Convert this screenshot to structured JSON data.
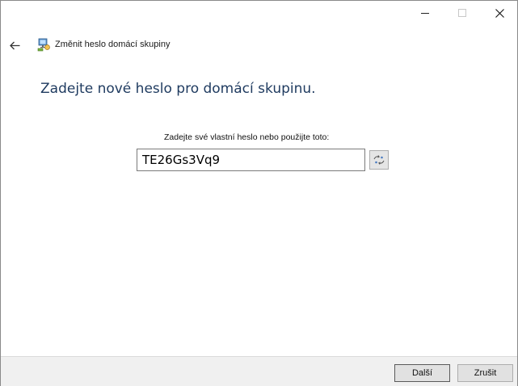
{
  "window": {
    "minimize_icon": "minimize-icon",
    "maximize_icon": "maximize-icon",
    "close_icon": "close-icon"
  },
  "nav": {
    "back_icon": "back-arrow-icon",
    "app_icon": "homegroup-icon",
    "title": "Změnit heslo domácí skupiny"
  },
  "main": {
    "heading": "Zadejte nové heslo pro domácí skupinu.",
    "password_label": "Zadejte své vlastní heslo nebo použijte toto:",
    "password_value": "TE26Gs3Vq9",
    "regenerate_icon": "refresh-icon"
  },
  "footer": {
    "next_label": "Další",
    "cancel_label": "Zrušit"
  },
  "colors": {
    "heading": "#1e3a5f",
    "footer_bg": "#f0f0f0",
    "button_bg": "#e1e1e1"
  }
}
